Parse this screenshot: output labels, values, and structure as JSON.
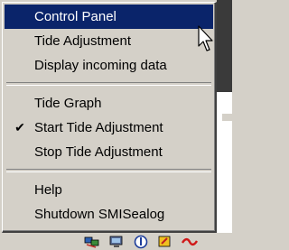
{
  "menu": {
    "items": [
      {
        "label": "Control Panel",
        "highlighted": true,
        "checked": false
      },
      {
        "label": "Tide Adjustment",
        "highlighted": false,
        "checked": false
      },
      {
        "label": "Display incoming data",
        "highlighted": false,
        "checked": false
      },
      {
        "label": "Tide Graph",
        "highlighted": false,
        "checked": false
      },
      {
        "label": "Start Tide Adjustment",
        "highlighted": false,
        "checked": true
      },
      {
        "label": "Stop Tide Adjustment",
        "highlighted": false,
        "checked": false
      },
      {
        "label": "Help",
        "highlighted": false,
        "checked": false
      },
      {
        "label": "Shutdown SMISealog",
        "highlighted": false,
        "checked": false
      }
    ],
    "check_glyph": "✔"
  },
  "tray": {
    "icons": [
      "network-icon",
      "monitor-icon",
      "shield-icon",
      "alert-icon",
      "sealog-icon"
    ]
  },
  "colors": {
    "menu_bg": "#d4d0c8",
    "highlight_bg": "#0a246a",
    "highlight_text": "#ffffff"
  }
}
